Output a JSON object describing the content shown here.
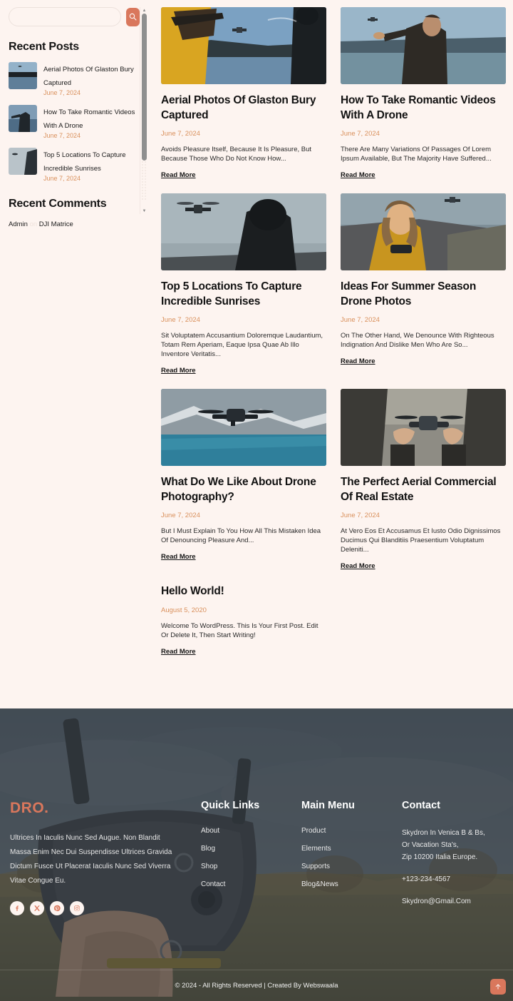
{
  "theme": {
    "page_bg": "#fdf4f0",
    "accent": "#d9775c",
    "date_color": "#d9905c",
    "footer_bg": "#55595d"
  },
  "sidebar": {
    "search": {
      "value": "",
      "placeholder": "",
      "button_icon": "search-icon"
    },
    "recent_posts": {
      "title": "Recent Posts",
      "items": [
        {
          "title": "Aerial Photos Of Glaston Bury Captured",
          "date": "June 7, 2024",
          "thumb": "drone-over-lake-thumb"
        },
        {
          "title": "How To Take Romantic Videos With A Drone",
          "date": "June 7, 2024",
          "thumb": "man-reaching-drone-thumb"
        },
        {
          "title": "Top 5 Locations To Capture Incredible Sunrises",
          "date": "June 7, 2024",
          "thumb": "silhouette-drone-thumb"
        }
      ]
    },
    "recent_comments": {
      "title": "Recent Comments",
      "items": [
        {
          "author": "Admin",
          "connector": "on",
          "post": "DJI Matrice"
        }
      ]
    },
    "scrollbar": {
      "up_arrow": "▲",
      "down_arrow": "▼"
    }
  },
  "posts": [
    {
      "title": "Aerial Photos Of Glaston Bury Captured",
      "date": "June 7, 2024",
      "excerpt": "Avoids Pleasure Itself, Because It Is Pleasure, But Because Those Who Do Not Know How...",
      "read_more": "Read More",
      "image": "couple-watching-drone-over-lake",
      "has_image": true
    },
    {
      "title": "How To Take Romantic Videos With A Drone",
      "date": "June 7, 2024",
      "excerpt": "There Are Many Variations Of Passages Of Lorem Ipsum Available, But The Majority Have Suffered...",
      "read_more": "Read More",
      "image": "man-reaching-out-to-drone-by-lake",
      "has_image": true
    },
    {
      "title": "Top 5 Locations To Capture Incredible Sunrises",
      "date": "June 7, 2024",
      "excerpt": "Sit Voluptatem Accusantium Doloremque Laudantium, Totam Rem Aperiam, Eaque Ipsa Quae Ab Illo Inventore Veritatis...",
      "read_more": "Read More",
      "image": "silhouette-person-with-drone-in-sky",
      "has_image": true
    },
    {
      "title": "Ideas For Summer Season Drone Photos",
      "date": "June 7, 2024",
      "excerpt": "On The Other Hand, We Denounce With Righteous Indignation And Dislike Men Who Are So...",
      "read_more": "Read More",
      "image": "woman-in-yellow-with-drone-controller",
      "has_image": true
    },
    {
      "title": "What Do We Like About Drone Photography?",
      "date": "June 7, 2024",
      "excerpt": "But I Must Explain To You How All This Mistaken Idea Of Denouncing Pleasure And...",
      "read_more": "Read More",
      "image": "drone-flying-over-mountain-sea",
      "has_image": true
    },
    {
      "title": "The Perfect Aerial Commercial Of Real Estate",
      "date": "June 7, 2024",
      "excerpt": "At Vero Eos Et Accusamus Et Iusto Odio Dignissimos Ducimus Qui Blanditiis Praesentium Voluptatum Deleniti...",
      "read_more": "Read More",
      "image": "hands-holding-small-drone",
      "has_image": true
    },
    {
      "title": "Hello World!",
      "date": "August 5, 2020",
      "excerpt": "Welcome To WordPress. This Is Your First Post. Edit Or Delete It, Then Start Writing!",
      "read_more": "Read More",
      "image": "",
      "has_image": false
    }
  ],
  "footer": {
    "brand": {
      "name": "DRO",
      "dot": "."
    },
    "about_text": "Ultrices In Iaculis Nunc Sed Augue. Non Blandit Massa Enim Nec Dui Suspendisse Ultrices Gravida Dictum Fusce Ut Placerat Iaculis Nunc Sed Viverra Vitae Congue Eu.",
    "socials": [
      {
        "name": "facebook-icon"
      },
      {
        "name": "x-twitter-icon"
      },
      {
        "name": "pinterest-icon"
      },
      {
        "name": "instagram-icon"
      }
    ],
    "quick_links": {
      "title": "Quick Links",
      "items": [
        "About",
        "Blog",
        "Shop",
        "Contact"
      ]
    },
    "main_menu": {
      "title": "Main Menu",
      "items": [
        "Product",
        "Elements",
        "Supports",
        "Blog&News"
      ]
    },
    "contact": {
      "title": "Contact",
      "address_line1": "Skydron In Venica B & Bs,",
      "address_line2": "Or Vacation Sta's,",
      "address_line3": "Zip 10200 Italia Europe.",
      "phone": "+123-234-4567",
      "email": "Skydron@Gmail.Com"
    },
    "copyright": "© 2024 - All Rights Reserved | Created By Webswaala",
    "to_top_icon": "arrow-up-icon"
  }
}
